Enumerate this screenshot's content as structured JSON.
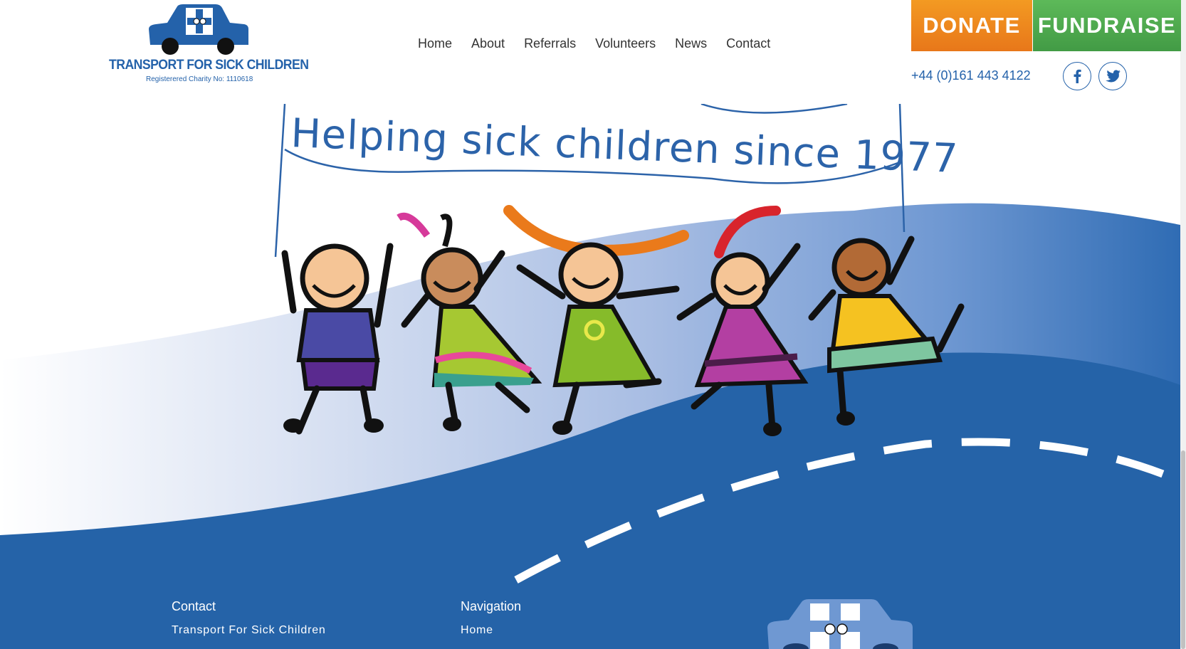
{
  "header": {
    "logo": {
      "title": "TRANSPORT FOR SICK CHILDREN",
      "subtitle": "Registerered Charity No: 1110618",
      "icon": "car-with-cross-icon"
    },
    "nav": {
      "items": [
        {
          "label": "Home"
        },
        {
          "label": "About"
        },
        {
          "label": "Referrals"
        },
        {
          "label": "Volunteers"
        },
        {
          "label": "News"
        },
        {
          "label": "Contact"
        }
      ]
    },
    "donate_label": "DONATE",
    "fundraise_label": "FUNDRAISE",
    "phone": "+44 (0)161 443 4122",
    "social": [
      {
        "icon": "facebook-icon"
      },
      {
        "icon": "twitter-icon"
      }
    ]
  },
  "hero": {
    "banner_text": "Helping sick children since 1977"
  },
  "footer": {
    "contact": {
      "heading": "Contact",
      "line1": "Transport For Sick Children"
    },
    "navigation": {
      "heading": "Navigation",
      "first_link": "Home"
    }
  },
  "colors": {
    "brand_blue": "#2462aa",
    "donate_orange": "#e8771a",
    "fundraise_green": "#429b45",
    "road_blue": "#2563a8",
    "wave_light": "#b9c9e8"
  }
}
